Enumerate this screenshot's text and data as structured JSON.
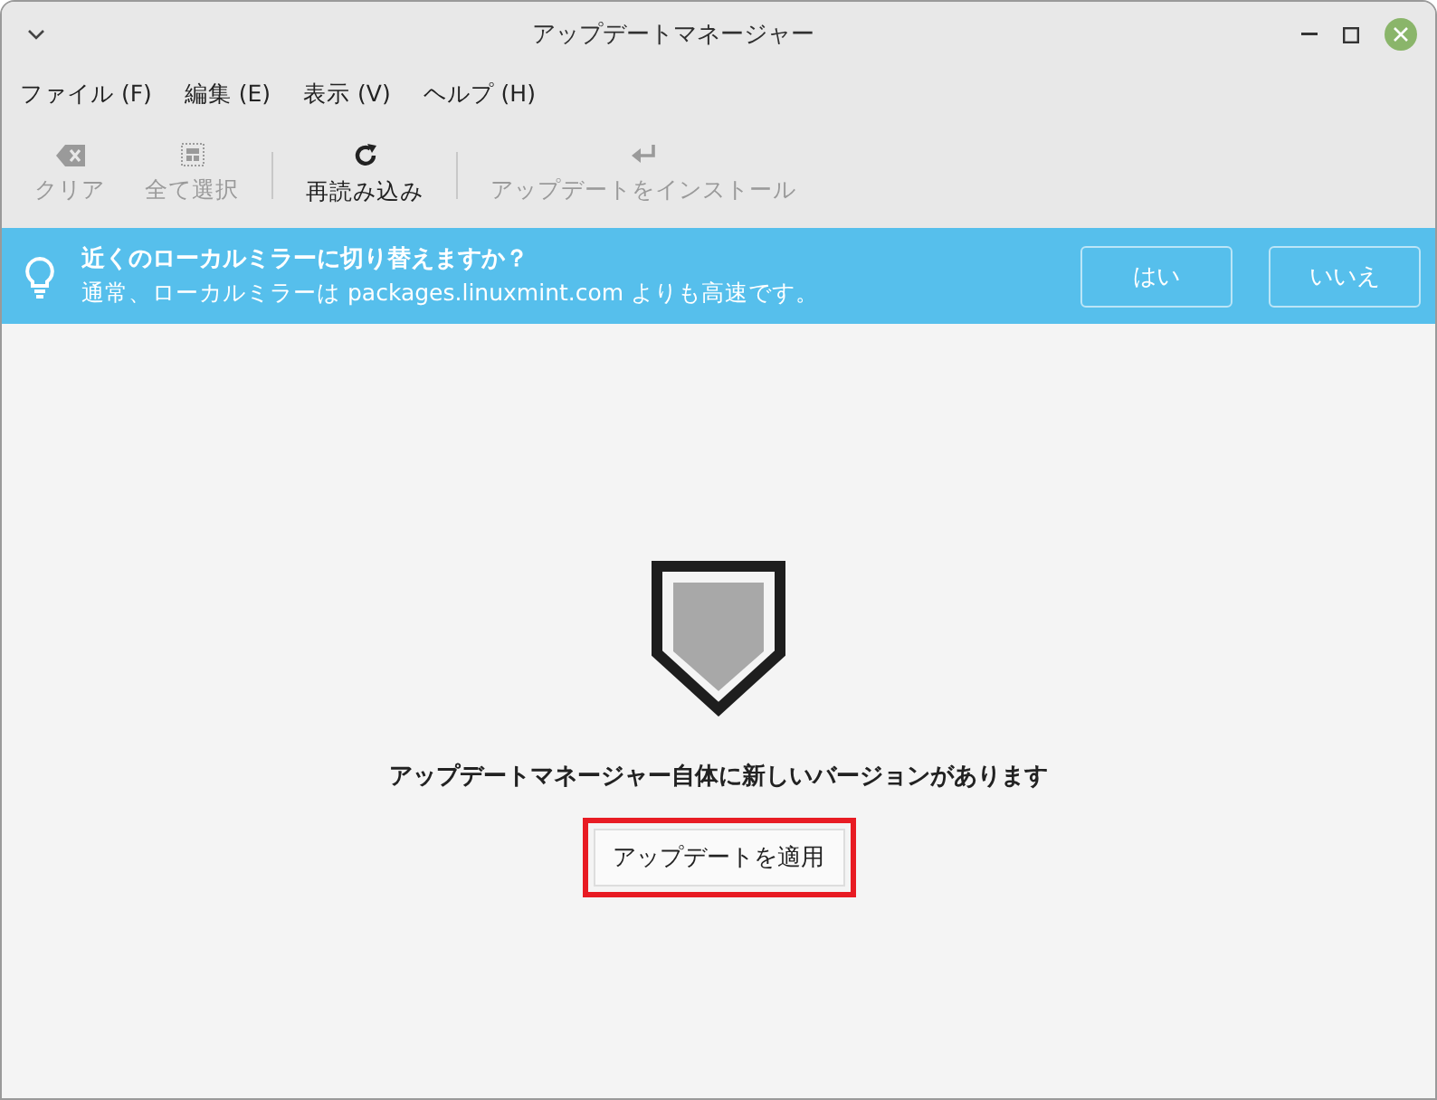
{
  "window": {
    "title": "アップデートマネージャー"
  },
  "menu": [
    {
      "label": "ファイル (F)"
    },
    {
      "label": "編集 (E)"
    },
    {
      "label": "表示 (V)"
    },
    {
      "label": "ヘルプ (H)"
    }
  ],
  "toolbar": [
    {
      "kind": "clear",
      "label": "クリア",
      "disabled": true
    },
    {
      "kind": "select-all",
      "label": "全て選択",
      "disabled": true
    },
    {
      "kind": "separator"
    },
    {
      "kind": "refresh",
      "label": "再読み込み",
      "disabled": false
    },
    {
      "kind": "separator"
    },
    {
      "kind": "install",
      "label": "アップデートをインストール",
      "disabled": true
    }
  ],
  "infobar": {
    "title": "近くのローカルミラーに切り替えますか？",
    "message": "通常、ローカルミラーは packages.linuxmint.com よりも高速です。",
    "buttons": [
      {
        "label": "はい"
      },
      {
        "label": "いいえ"
      }
    ]
  },
  "main": {
    "message": "アップデートマネージャー自体に新しいバージョンがあります",
    "button": {
      "label": "アップデートを適用",
      "highlighted": true
    }
  }
}
